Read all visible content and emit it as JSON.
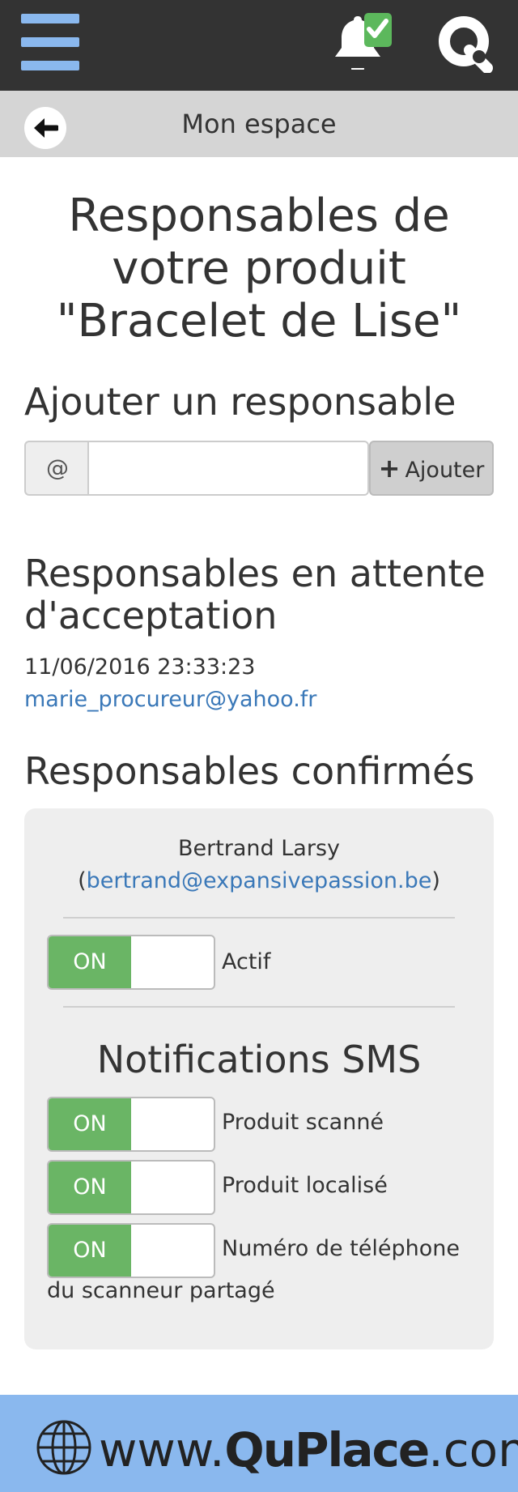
{
  "header": {
    "menu_icon": "hamburger-icon",
    "notification_icon": "bell-check-icon",
    "logo_icon": "quplace-q-logo"
  },
  "subheader": {
    "back_icon": "arrow-left-icon",
    "title": "Mon espace"
  },
  "page": {
    "title_line1": "Responsables de",
    "title_line2": "votre produit",
    "title_line3": "\"Bracelet de Lise\""
  },
  "add_section": {
    "heading": "Ajouter un responsable",
    "addon": "@",
    "input_value": "",
    "input_placeholder": "",
    "button_label": "Ajouter"
  },
  "pending": {
    "heading_line1": "Responsables en attente",
    "heading_line2": "d'acceptation",
    "date": "11/06/2016 23:33:23",
    "email": "marie_procureur@yahoo.fr"
  },
  "confirmed": {
    "heading": "Responsables confirmés",
    "name": "Bertrand Larsy",
    "email_open": "(",
    "email": "bertrand@expansivepassion.be",
    "email_close": ")",
    "active_toggle": {
      "state": "ON",
      "label": "Actif"
    },
    "sms_heading": "Notifications SMS",
    "sms_toggles": [
      {
        "state": "ON",
        "label": "Produit scanné"
      },
      {
        "state": "ON",
        "label": "Produit localisé"
      },
      {
        "state": "ON",
        "label": "Numéro de téléphone",
        "label_cont": "du scanneur partagé"
      }
    ]
  },
  "footer": {
    "globe_icon": "globe-icon",
    "url_prefix": "www.",
    "brand": "QuPlace",
    "url_suffix": ".com"
  },
  "colors": {
    "topbar": "#333333",
    "accent_blue": "#8ab8ee",
    "link": "#3a78b8",
    "toggle_on": "#6ab565",
    "card_bg": "#eeeeee"
  }
}
